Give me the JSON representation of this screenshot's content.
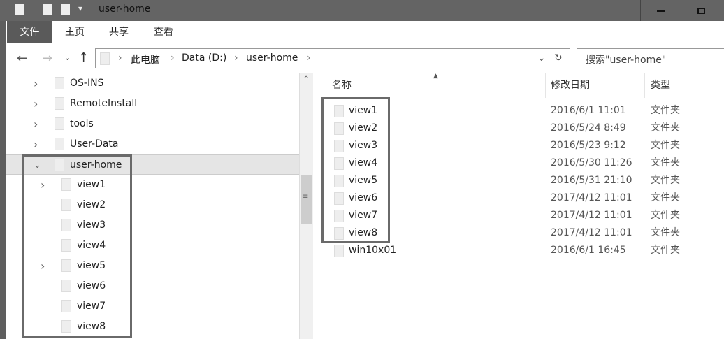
{
  "window": {
    "title": "user-home"
  },
  "ribbon": {
    "tabs": [
      "文件",
      "主页",
      "共享",
      "查看"
    ]
  },
  "address": {
    "crumbs": [
      "此电脑",
      "Data (D:)",
      "user-home"
    ],
    "search_placeholder": "搜索\"user-home\""
  },
  "tree": {
    "items": [
      {
        "label": "OS-INS",
        "expand": ">"
      },
      {
        "label": "RemoteInstall",
        "expand": ">"
      },
      {
        "label": "tools",
        "expand": ">"
      },
      {
        "label": "User-Data",
        "expand": ">"
      },
      {
        "label": "user-home",
        "expand": "v"
      },
      {
        "label": "view1",
        "expand": ">"
      },
      {
        "label": "view2",
        "expand": ""
      },
      {
        "label": "view3",
        "expand": ""
      },
      {
        "label": "view4",
        "expand": ""
      },
      {
        "label": "view5",
        "expand": ">"
      },
      {
        "label": "view6",
        "expand": ""
      },
      {
        "label": "view7",
        "expand": ""
      },
      {
        "label": "view8",
        "expand": ""
      }
    ]
  },
  "list": {
    "headers": {
      "name": "名称",
      "date": "修改日期",
      "type": "类型"
    },
    "rows": [
      {
        "name": "view1",
        "date": "2016/6/1 11:01",
        "type": "文件夹"
      },
      {
        "name": "view2",
        "date": "2016/5/24 8:49",
        "type": "文件夹"
      },
      {
        "name": "view3",
        "date": "2016/5/23 9:12",
        "type": "文件夹"
      },
      {
        "name": "view4",
        "date": "2016/5/30 11:26",
        "type": "文件夹"
      },
      {
        "name": "view5",
        "date": "2016/5/31 21:10",
        "type": "文件夹"
      },
      {
        "name": "view6",
        "date": "2017/4/12 11:01",
        "type": "文件夹"
      },
      {
        "name": "view7",
        "date": "2017/4/12 11:01",
        "type": "文件夹"
      },
      {
        "name": "view8",
        "date": "2017/4/12 11:01",
        "type": "文件夹"
      },
      {
        "name": "win10x01",
        "date": "2016/6/1 16:45",
        "type": "文件夹"
      }
    ]
  }
}
